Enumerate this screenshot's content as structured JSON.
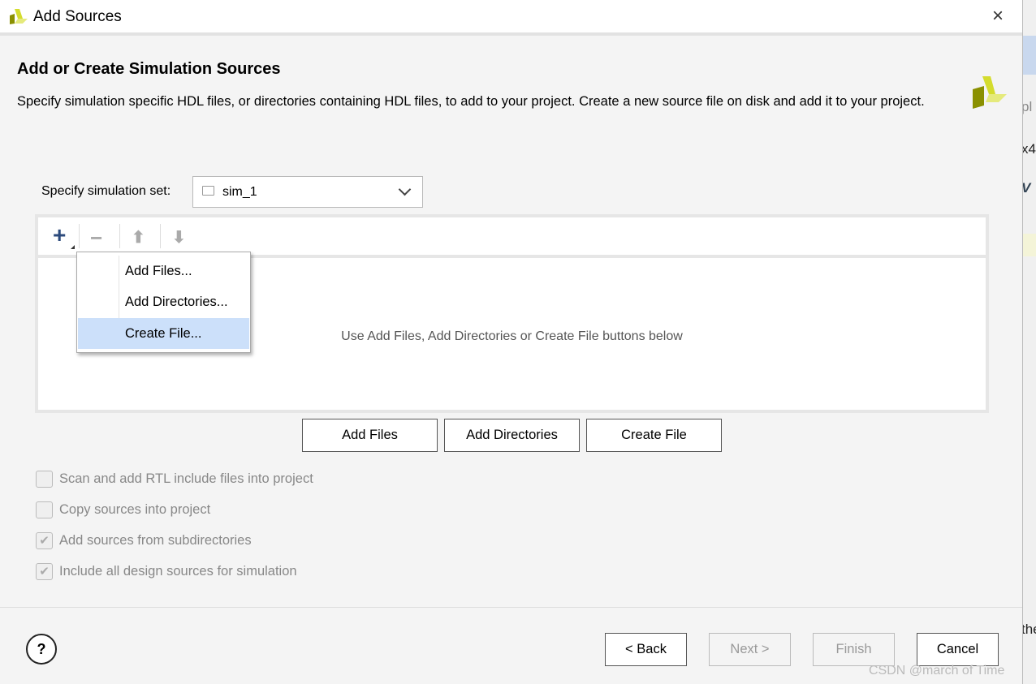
{
  "window": {
    "title": "Add Sources",
    "close_icon": "×"
  },
  "header": {
    "title": "Add or Create Simulation Sources",
    "description": "Specify simulation specific HDL files, or directories containing HDL files, to add to your project. Create a new source file on disk and add it to your project."
  },
  "simulation_set": {
    "label": "Specify simulation set:",
    "value": "sim_1"
  },
  "toolbar": {
    "add": "+",
    "remove": "−",
    "up": "⬆",
    "down": "⬇"
  },
  "file_list": {
    "empty_hint": "Use Add Files, Add Directories or Create File buttons below"
  },
  "add_menu": {
    "items": [
      "Add Files...",
      "Add Directories...",
      "Create File..."
    ],
    "selected": "Create File..."
  },
  "buttons": {
    "add_files": "Add Files",
    "add_directories": "Add Directories",
    "create_file": "Create File"
  },
  "options": [
    {
      "label": "Scan and add RTL include files into project",
      "checked": false
    },
    {
      "label": "Copy sources into project",
      "checked": false
    },
    {
      "label": "Add sources from subdirectories",
      "checked": true
    },
    {
      "label": "Include all design sources for simulation",
      "checked": true
    }
  ],
  "footer": {
    "help": "?",
    "back": "< Back",
    "next": "Next >",
    "finish": "Finish",
    "cancel": "Cancel"
  },
  "background_window": {
    "fragments": [
      "pl",
      "x4",
      "V",
      "the"
    ]
  },
  "watermark": "CSDN @march of Time",
  "colors": {
    "accent_selection": "#cce0fa",
    "logo_yellow": "#d4dc2e",
    "logo_olive": "#8a9000"
  }
}
